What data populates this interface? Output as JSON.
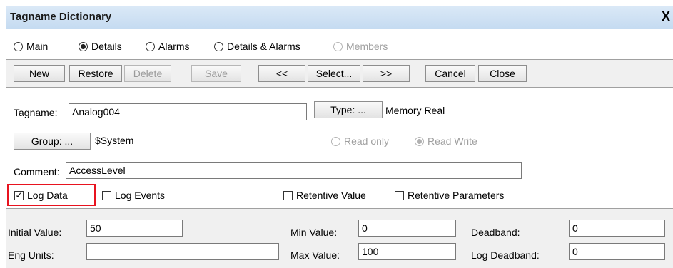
{
  "window": {
    "title": "Tagname Dictionary",
    "close_glyph": "X"
  },
  "view_options": [
    {
      "label": "Main",
      "selected": false,
      "disabled": false
    },
    {
      "label": "Details",
      "selected": true,
      "disabled": false
    },
    {
      "label": "Alarms",
      "selected": false,
      "disabled": false
    },
    {
      "label": "Details & Alarms",
      "selected": false,
      "disabled": false
    },
    {
      "label": "Members",
      "selected": false,
      "disabled": true
    }
  ],
  "toolbar": {
    "new": "New",
    "restore": "Restore",
    "delete": "Delete",
    "save": "Save",
    "prev": "<<",
    "select": "Select...",
    "next": ">>",
    "cancel": "Cancel",
    "close": "Close"
  },
  "tag": {
    "tagname_label": "Tagname:",
    "tagname_value": "Analog004",
    "type_button": "Type: ...",
    "type_value": "Memory Real",
    "group_button": "Group: ...",
    "group_value": "$System",
    "read_only": "Read only",
    "read_write": "Read Write",
    "comment_label": "Comment:",
    "comment_value": "AccessLevel"
  },
  "options": {
    "log_data": {
      "label": "Log Data",
      "checked": true
    },
    "log_events": {
      "label": "Log Events",
      "checked": false
    },
    "retentive_value": {
      "label": "Retentive Value",
      "checked": false
    },
    "retentive_parameters": {
      "label": "Retentive Parameters",
      "checked": false
    }
  },
  "details": {
    "initial_value_label": "Initial Value:",
    "initial_value": "50",
    "eng_units_label": "Eng Units:",
    "eng_units": "",
    "min_value_label": "Min Value:",
    "min_value": "0",
    "max_value_label": "Max Value:",
    "max_value": "100",
    "deadband_label": "Deadband:",
    "deadband": "0",
    "log_deadband_label": "Log Deadband:",
    "log_deadband": "0"
  },
  "colors": {
    "highlight": "#e8131f",
    "title_bar": "#c5dbf1"
  }
}
